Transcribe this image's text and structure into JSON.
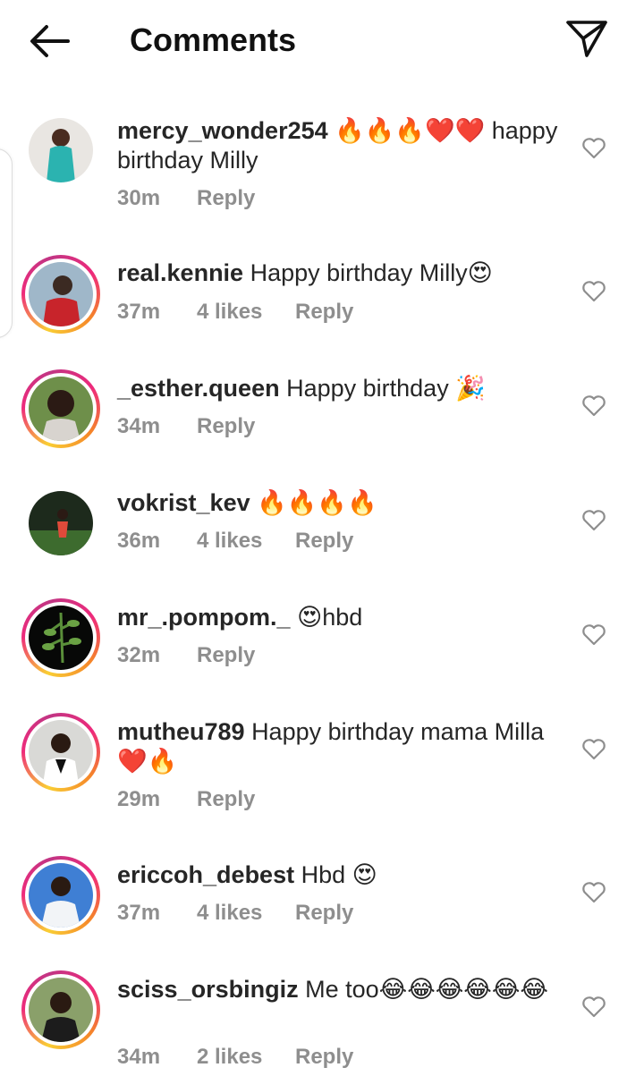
{
  "header": {
    "title": "Comments",
    "back_icon": "arrow-left-icon",
    "send_icon": "paper-plane-icon"
  },
  "reply_label": "Reply",
  "comments": [
    {
      "username": "mercy_wonder254",
      "text": "🔥🔥🔥❤️❤️ happy birthday Milly",
      "time": "30m",
      "likes": ""
    },
    {
      "username": "real.kennie",
      "text": "Happy birthday Milly😍",
      "time": "37m",
      "likes": "4 likes"
    },
    {
      "username": "_esther.queen",
      "text": "Happy birthday 🎉",
      "time": "34m",
      "likes": ""
    },
    {
      "username": "vokrist_kev",
      "text": "🔥🔥🔥🔥",
      "time": "36m",
      "likes": "4 likes"
    },
    {
      "username": "mr_.pompom._",
      "text": "😍hbd",
      "time": "32m",
      "likes": ""
    },
    {
      "username": "mutheu789",
      "text": "Happy birthday mama Milla ❤️🔥",
      "time": "29m",
      "likes": ""
    },
    {
      "username": "ericcoh_debest",
      "text": "Hbd 😍",
      "time": "37m",
      "likes": "4 likes"
    },
    {
      "username": "sciss_orsbingiz",
      "text": "Me too😂😂😂😂😂😂",
      "time": "34m",
      "likes": "2 likes"
    }
  ]
}
